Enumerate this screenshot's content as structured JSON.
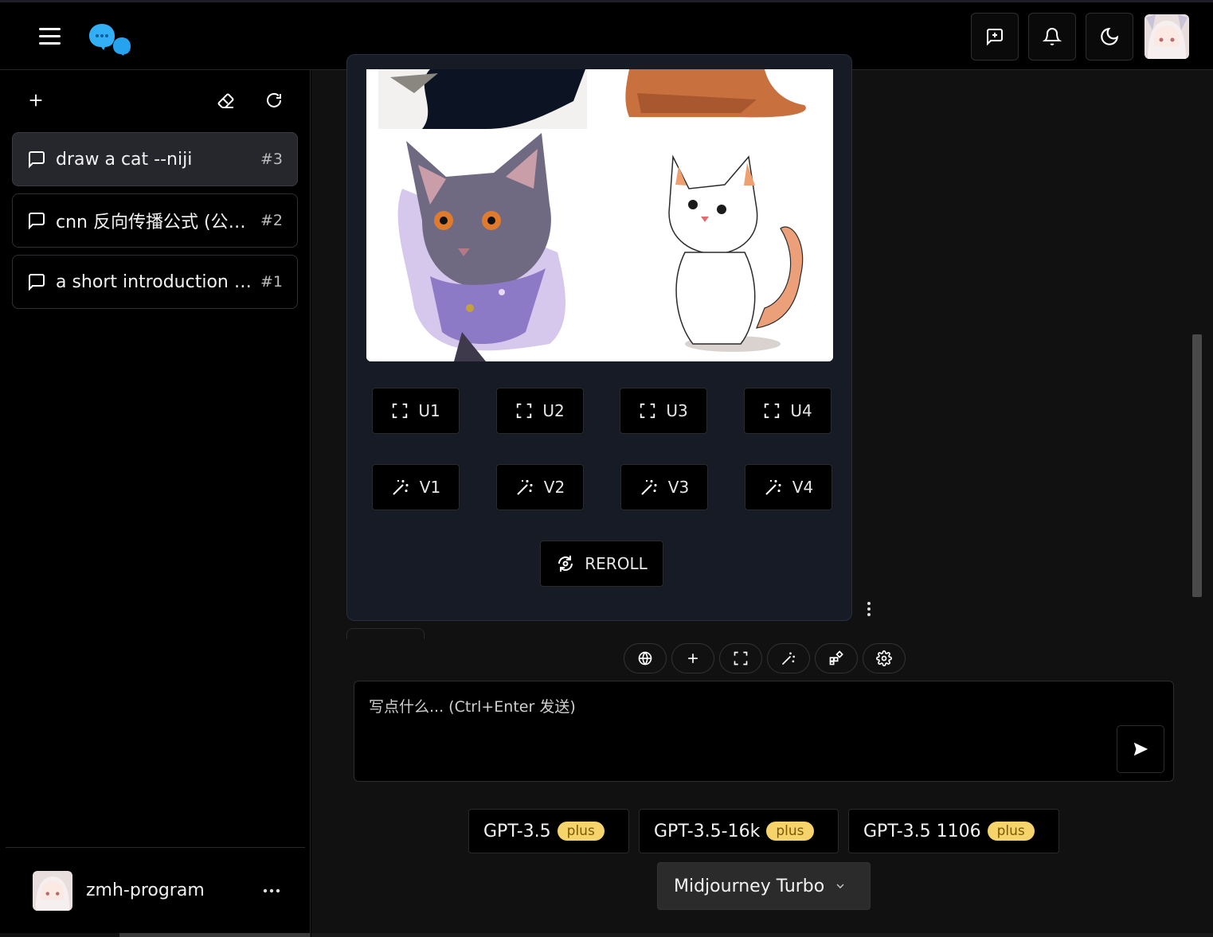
{
  "colors": {
    "accent": "#1da1f2",
    "plus_badge": "#f6d36b",
    "card_bg": "#161b26"
  },
  "header": {
    "icons": [
      "menu-icon",
      "chat-logo",
      "new-chat-icon",
      "bell-icon",
      "moon-icon",
      "user-avatar"
    ]
  },
  "sidebar": {
    "tools": [
      "plus-icon",
      "eraser-icon",
      "refresh-icon"
    ],
    "conversations": [
      {
        "title": "draw a cat --niji",
        "num": "#3",
        "active": true
      },
      {
        "title": "cnn 反向传播公式 (公式)",
        "num": "#2",
        "active": false
      },
      {
        "title": "a short introduction about cats",
        "num": "#1",
        "active": false
      }
    ],
    "user": {
      "name": "zmh-program"
    }
  },
  "card": {
    "upscale": [
      "U1",
      "U2",
      "U3",
      "U4"
    ],
    "variation": [
      "V1",
      "V2",
      "V3",
      "V4"
    ],
    "reroll": "REROLL"
  },
  "toolbar": {
    "pills": [
      "globe-icon",
      "plus-icon",
      "fullscreen-icon",
      "magic-wand-icon",
      "widgets-icon",
      "settings-icon"
    ]
  },
  "input": {
    "placeholder": "写点什么... (Ctrl+Enter 发送)",
    "value": ""
  },
  "models": [
    {
      "name": "GPT-3.5",
      "badge": "plus"
    },
    {
      "name": "GPT-3.5-16k",
      "badge": "plus"
    },
    {
      "name": "GPT-3.5 1106",
      "badge": "plus"
    }
  ],
  "model_select": {
    "value": "Midjourney Turbo"
  }
}
